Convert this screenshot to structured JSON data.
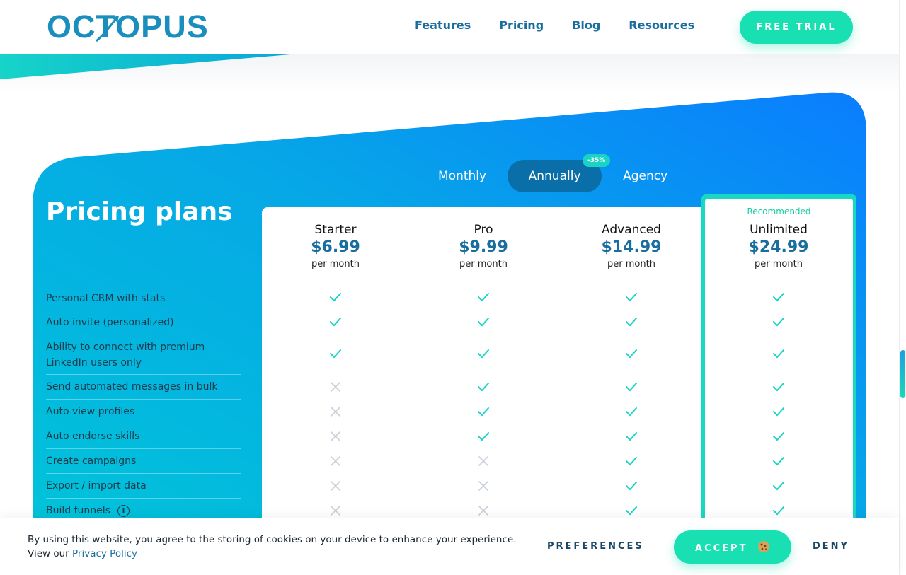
{
  "header": {
    "logo_text": "OCTOPUS",
    "nav": [
      "Features",
      "Pricing",
      "Blog",
      "Resources"
    ],
    "cta_label": "FREE TRIAL"
  },
  "pricing": {
    "title": "Pricing plans",
    "billing_options": [
      "Monthly",
      "Annually",
      "Agency"
    ],
    "selected_billing": "Annually",
    "discount_badge": "-35%",
    "recommended_label": "Recommended",
    "plans": [
      {
        "name": "Starter",
        "price": "$6.99",
        "period": "per month"
      },
      {
        "name": "Pro",
        "price": "$9.99",
        "period": "per month"
      },
      {
        "name": "Advanced",
        "price": "$14.99",
        "period": "per month"
      },
      {
        "name": "Unlimited",
        "price": "$24.99",
        "period": "per month"
      }
    ],
    "features": [
      {
        "label": "Personal CRM with stats",
        "included": [
          true,
          true,
          true,
          true
        ]
      },
      {
        "label": "Auto invite (personalized)",
        "included": [
          true,
          true,
          true,
          true
        ]
      },
      {
        "label": "Ability to connect with premium LinkedIn users only",
        "included": [
          true,
          true,
          true,
          true
        ]
      },
      {
        "label": "Send automated messages in bulk",
        "included": [
          false,
          true,
          true,
          true
        ]
      },
      {
        "label": "Auto view profiles",
        "included": [
          false,
          true,
          true,
          true
        ]
      },
      {
        "label": "Auto endorse skills",
        "included": [
          false,
          true,
          true,
          true
        ]
      },
      {
        "label": "Create campaigns",
        "included": [
          false,
          false,
          true,
          true
        ]
      },
      {
        "label": "Export / import data",
        "included": [
          false,
          false,
          true,
          true
        ]
      },
      {
        "label": "Build funnels",
        "included": [
          false,
          false,
          true,
          true
        ],
        "info": true
      }
    ]
  },
  "cookie": {
    "text": "By using this website, you agree to the storing of cookies on your device to enhance your experience. View our",
    "link": "Privacy Policy",
    "preferences": "PREFERENCES",
    "accept": "ACCEPT",
    "deny": "DENY"
  },
  "colors": {
    "brand_blue": "#1a6e9f",
    "accent_green": "#18e0b2",
    "check": "#19d3c4",
    "cross": "#c7d0d8"
  },
  "icons": {
    "check": "check-icon",
    "cross": "cross-icon",
    "info": "info-icon",
    "cookie": "cookie-icon"
  }
}
